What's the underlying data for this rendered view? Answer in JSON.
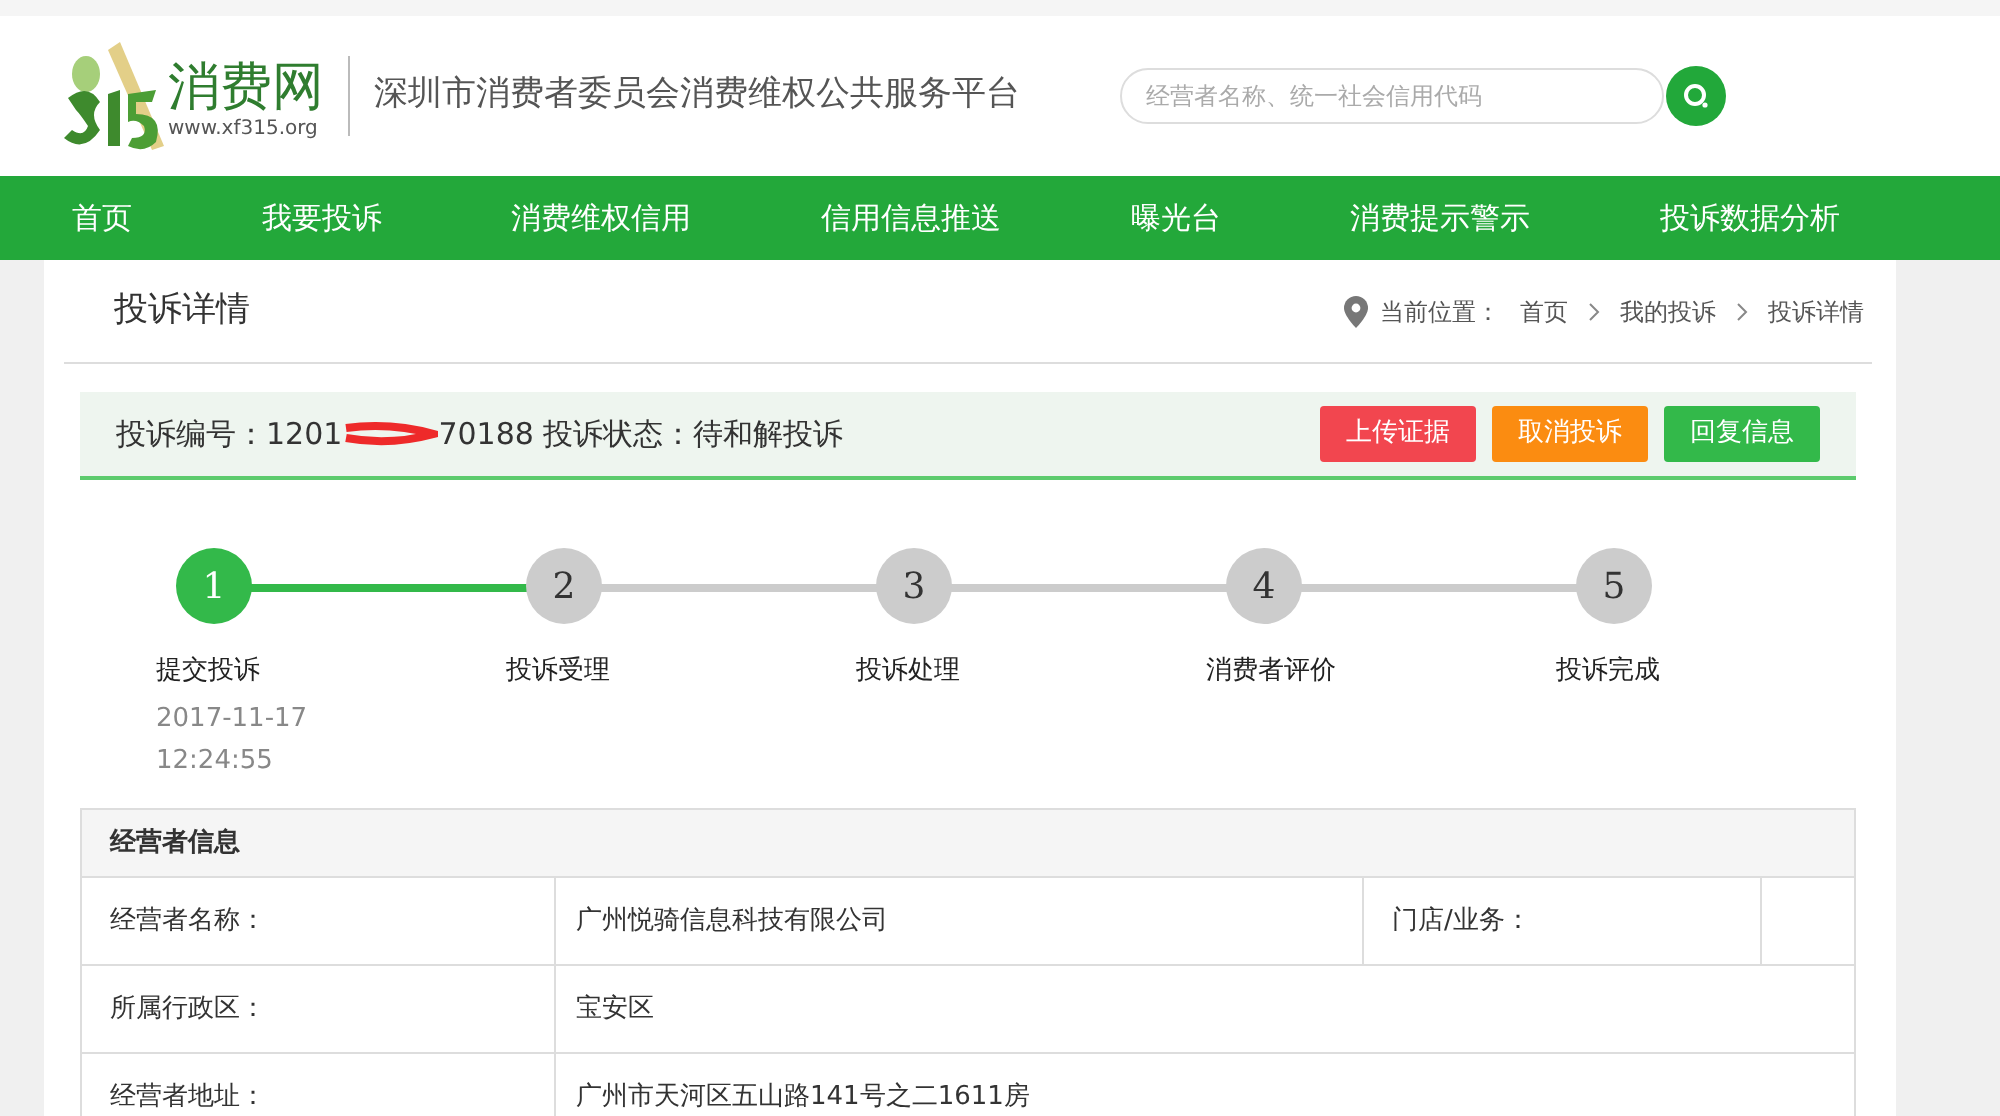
{
  "header": {
    "logo_text": "消费网",
    "logo_url": "www.xf315.org",
    "platform_title": "深圳市消费者委员会消费维权公共服务平台",
    "search": {
      "placeholder": "经营者名称、统一社会信用代码"
    }
  },
  "nav": [
    {
      "label": "首页"
    },
    {
      "label": "我要投诉"
    },
    {
      "label": "消费维权信用"
    },
    {
      "label": "信用信息推送"
    },
    {
      "label": "曝光台"
    },
    {
      "label": "消费提示警示"
    },
    {
      "label": "投诉数据分析"
    }
  ],
  "page_title": "投诉详情",
  "breadcrumb": {
    "label": "当前位置：",
    "items": [
      "首页",
      "我的投诉",
      "投诉详情"
    ]
  },
  "complaint": {
    "number_prefix": "投诉编号：1201",
    "number_suffix": "70188",
    "status": "投诉状态：待和解投诉",
    "actions": [
      {
        "label": "上传证据",
        "color": "#f2464f"
      },
      {
        "label": "取消投诉",
        "color": "#fb8c11"
      },
      {
        "label": "回复信息",
        "color": "#33b94a"
      }
    ]
  },
  "steps": [
    {
      "number": "1",
      "label": "提交投诉",
      "date": "2017-11-17",
      "time": "12:24:55",
      "done": true
    },
    {
      "number": "2",
      "label": "投诉受理",
      "done": false
    },
    {
      "number": "3",
      "label": "投诉处理",
      "done": false
    },
    {
      "number": "4",
      "label": "消费者评价",
      "done": false
    },
    {
      "number": "5",
      "label": "投诉完成",
      "done": false
    }
  ],
  "operator_info": {
    "title": "经营者信息",
    "rows": [
      {
        "label": "经营者名称：",
        "value": "广州悦骑信息科技有限公司",
        "extra_label": "门店/业务："
      },
      {
        "label": "所属行政区：",
        "value": "宝安区"
      },
      {
        "label": "经营者地址：",
        "value": "广州市天河区五山路141号之二1611房"
      }
    ]
  }
}
